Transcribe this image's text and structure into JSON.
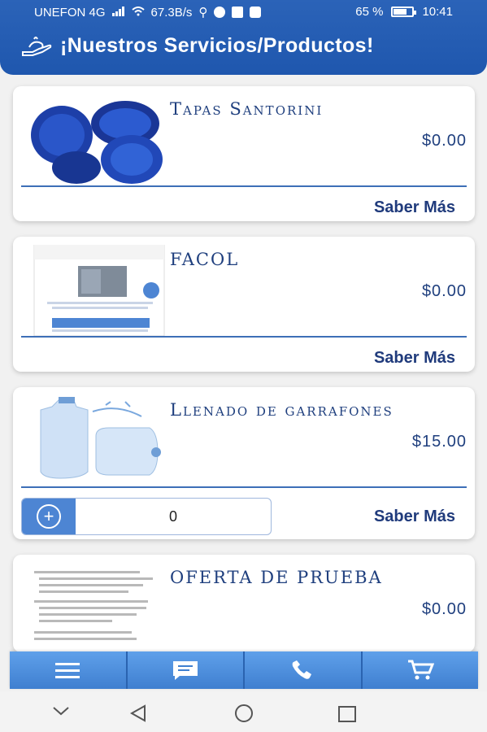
{
  "status_bar": {
    "carrier": "UNEFON 4G",
    "speed": "67.3B/s",
    "battery": "65 %",
    "time": "10:41"
  },
  "header": {
    "title": "¡Nuestros Servicios/Productos!",
    "icon": "hand-icon"
  },
  "products": [
    {
      "name": "Tapas Santorini",
      "price": "$0.00",
      "more_label": "Saber Más"
    },
    {
      "name": "FACOL",
      "price": "$0.00",
      "more_label": "Saber Más"
    },
    {
      "name": "Llenado de garrafones",
      "price": "$15.00",
      "more_label": "Saber Más",
      "quantity": "0"
    },
    {
      "name": "OFERTA DE PRUEBA",
      "price": "$0.00"
    }
  ],
  "bottom_nav": [
    {
      "icon": "menu-icon"
    },
    {
      "icon": "chat-icon"
    },
    {
      "icon": "phone-icon"
    },
    {
      "icon": "cart-icon"
    }
  ],
  "colors": {
    "brand": "#2b63b8",
    "accent": "#4d85d3",
    "text": "#1f3f7e"
  }
}
